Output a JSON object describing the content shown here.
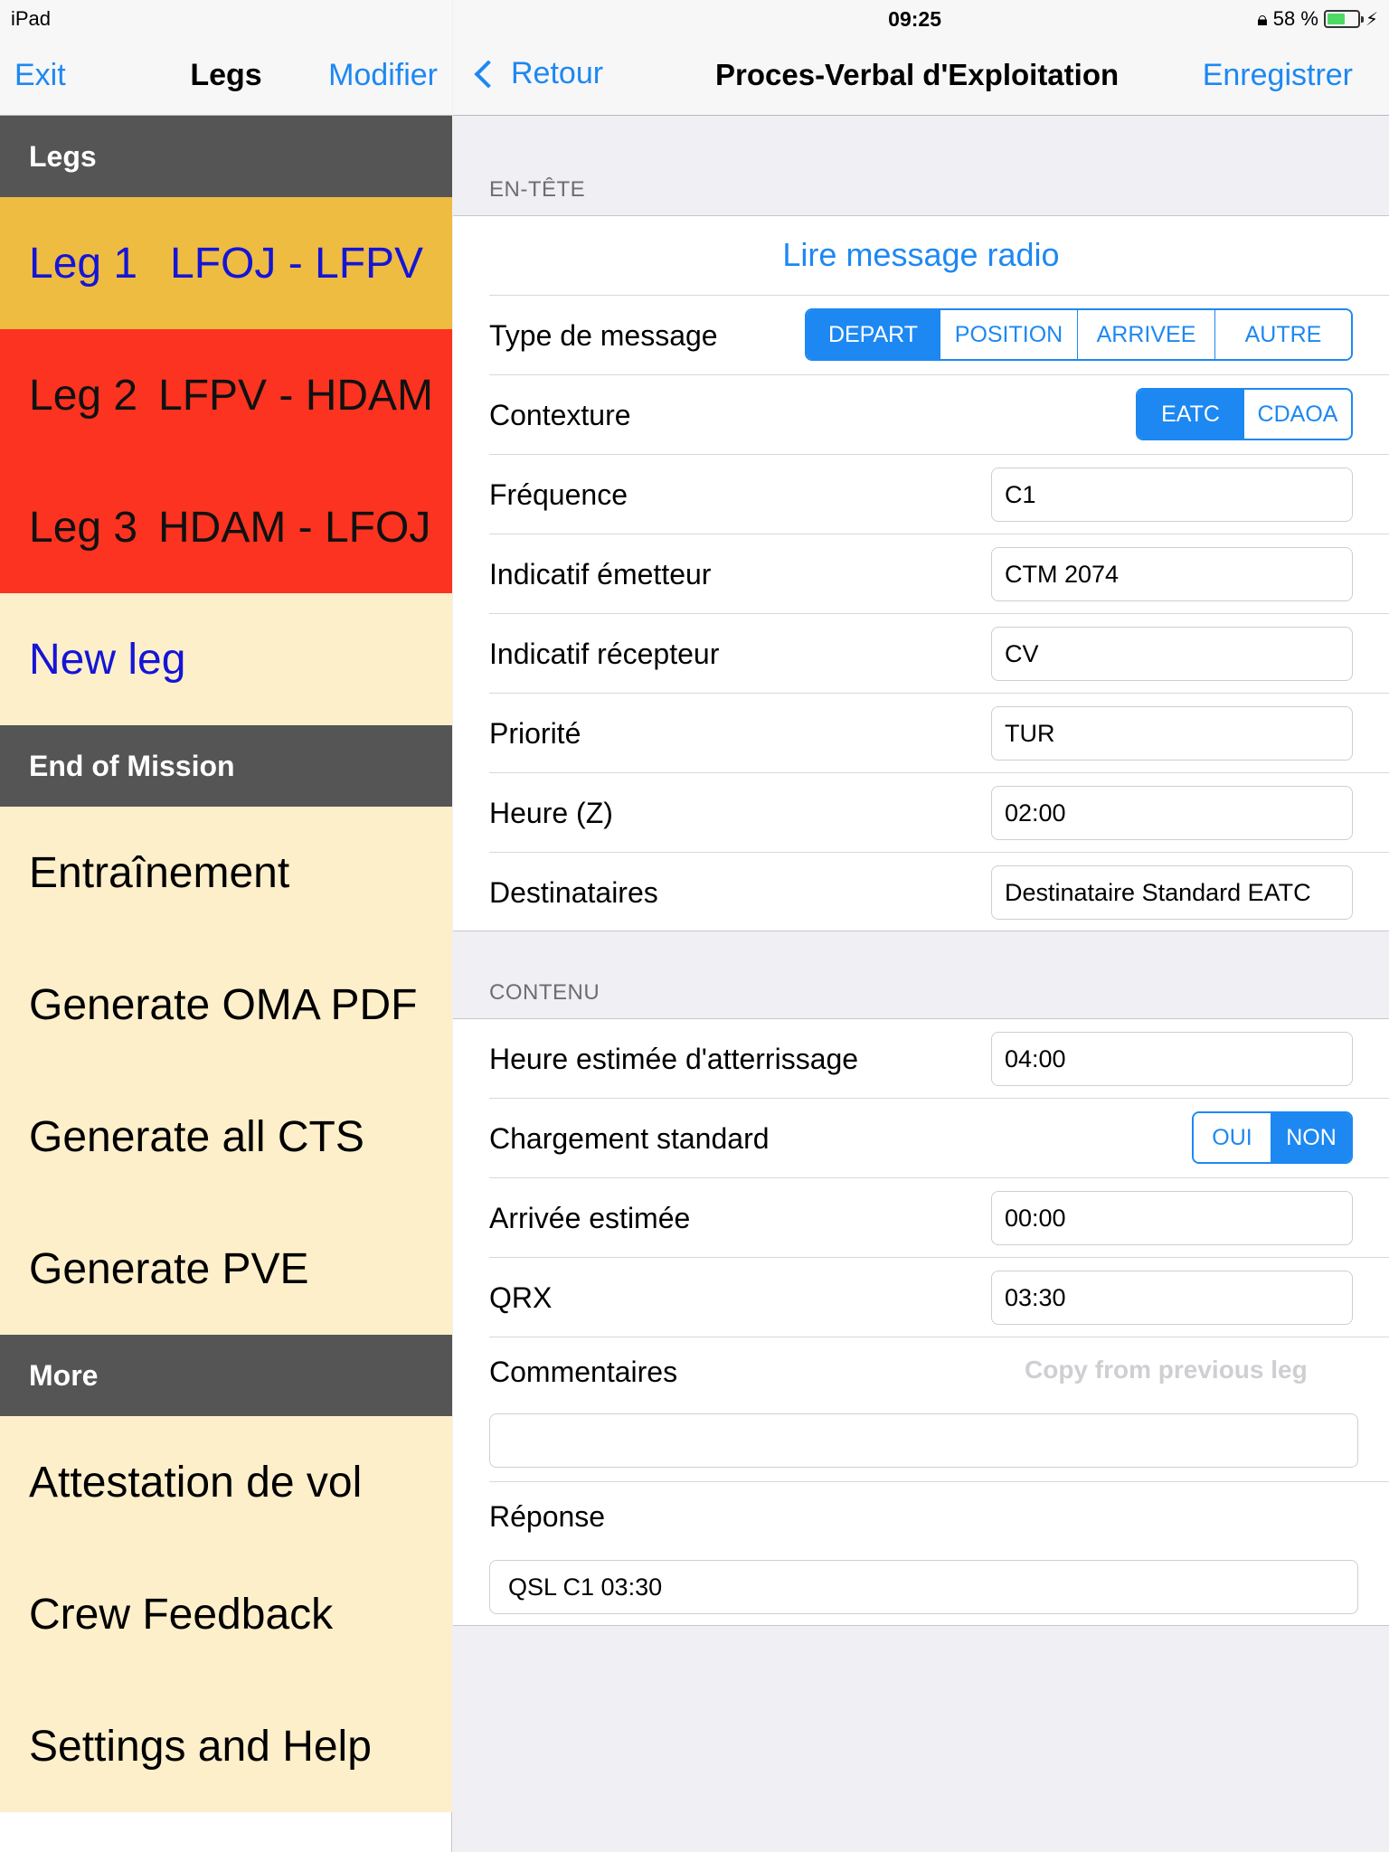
{
  "status_bar": {
    "device": "iPad",
    "time": "09:25",
    "battery": "58 %",
    "battery_level": 0.58
  },
  "left_nav": {
    "exit_label": "Exit",
    "title": "Legs",
    "modifier_label": "Modifier"
  },
  "sections": {
    "legs": "Legs",
    "end_of_mission": "End of Mission",
    "more": "More"
  },
  "legs": [
    {
      "num": "Leg 1",
      "route": "LFOJ - LFPV",
      "state": "selected",
      "color": "#efbc42"
    },
    {
      "num": "Leg 2",
      "route": "LFPV - HDAM",
      "state": "error",
      "color": "#fc3320"
    },
    {
      "num": "Leg 3",
      "route": "HDAM - LFOJ",
      "state": "error",
      "color": "#fc3320"
    }
  ],
  "new_leg_label": "New leg",
  "end_of_mission_items": [
    "Entraînement",
    "Generate OMA PDF",
    "Generate all CTS",
    "Generate PVE"
  ],
  "more_items": [
    "Attestation de vol",
    "Crew Feedback",
    "Settings and Help"
  ],
  "right_nav": {
    "back_label": "Retour",
    "title": "Proces-Verbal d'Exploitation",
    "save_label": "Enregistrer"
  },
  "header_section": {
    "label": "EN-TÊTE",
    "read_radio": "Lire message radio",
    "message_type": {
      "label": "Type  de message",
      "options": [
        "DEPART",
        "POSITION",
        "ARRIVEE",
        "AUTRE"
      ],
      "selected": "DEPART"
    },
    "contexture": {
      "label": "Contexture",
      "options": [
        "EATC",
        "CDAOA"
      ],
      "selected": "EATC"
    },
    "frequence": {
      "label": "Fréquence",
      "value": "C1"
    },
    "indicatif_emetteur": {
      "label": "Indicatif émetteur",
      "value": "CTM 2074"
    },
    "indicatif_recepteur": {
      "label": "Indicatif récepteur",
      "value": "CV"
    },
    "priorite": {
      "label": "Priorité",
      "value": "TUR"
    },
    "heure": {
      "label": "Heure (Z)",
      "value": "02:00"
    },
    "destinataires": {
      "label": "Destinataires",
      "value": "Destinataire Standard EATC"
    }
  },
  "content_section": {
    "label": "CONTENU",
    "heure_estimee": {
      "label": "Heure estimée d'atterrissage",
      "value": "04:00"
    },
    "chargement": {
      "label": "Chargement standard",
      "options": [
        "OUI",
        "NON"
      ],
      "selected": "NON"
    },
    "arrivee": {
      "label": "Arrivée estimée",
      "value": "00:00"
    },
    "qrx": {
      "label": "QRX",
      "value": "03:30"
    },
    "commentaires": {
      "label": "Commentaires",
      "copy_label": "Copy from previous leg",
      "value": ""
    },
    "reponse": {
      "label": "Réponse",
      "value": "QSL C1 03:30"
    }
  },
  "colors": {
    "accent": "#1d88f2",
    "section_header": "#555555",
    "cream": "#fdefca",
    "leg_selected": "#efbc42",
    "leg_error": "#fc3320",
    "leg_link": "#1515d6"
  }
}
